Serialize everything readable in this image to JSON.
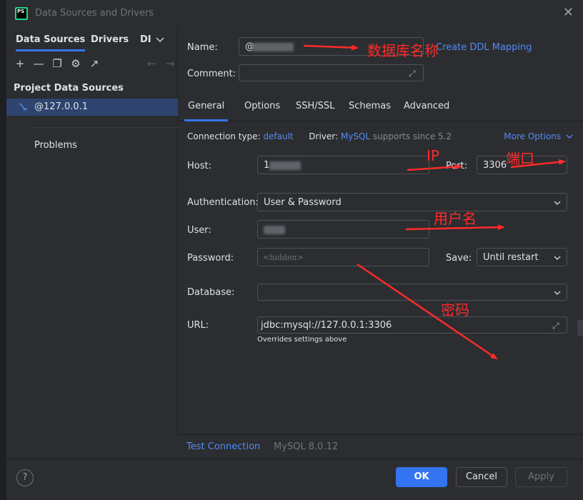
{
  "window": {
    "title": "Data Sources and Drivers",
    "logo_text": "PS"
  },
  "left": {
    "tabs": [
      "Data Sources",
      "Drivers",
      "DI"
    ],
    "section_title": "Project Data Sources",
    "data_source": "@127.0.0.1",
    "problems": "Problems"
  },
  "form": {
    "name_label": "Name:",
    "name_value": "@",
    "ddl_link": "Create DDL Mapping",
    "comment_label": "Comment:",
    "tabs": [
      "General",
      "Options",
      "SSH/SSL",
      "Schemas",
      "Advanced"
    ],
    "connection_type_label": "Connection type:",
    "connection_type_value": "default",
    "driver_label": "Driver:",
    "driver_value": "MySQL",
    "driver_suffix": "supports since 5.2",
    "more_options": "More Options",
    "host_label": "Host:",
    "host_value": "1",
    "port_label": "Port:",
    "port_value": "3306",
    "auth_label": "Authentication:",
    "auth_value": "User & Password",
    "user_label": "User:",
    "password_label": "Password:",
    "password_placeholder": "<hidden>",
    "save_label": "Save:",
    "save_value": "Until restart",
    "database_label": "Database:",
    "url_label": "URL:",
    "url_value": "jdbc:mysql://127.0.0.1:3306",
    "url_hint": "Overrides settings above"
  },
  "bottom": {
    "test_connection": "Test Connection",
    "version": "MySQL 8.0.12"
  },
  "footer": {
    "help": "?",
    "ok": "OK",
    "cancel": "Cancel",
    "apply": "Apply"
  },
  "annotations": {
    "name": "数据库名称",
    "ip": "IP",
    "port": "端口",
    "user": "用户名",
    "password": "密码"
  },
  "colors": {
    "accent": "#3574f0",
    "link": "#548af7",
    "annotation": "#ff2a2a",
    "selection": "#2e436e"
  }
}
